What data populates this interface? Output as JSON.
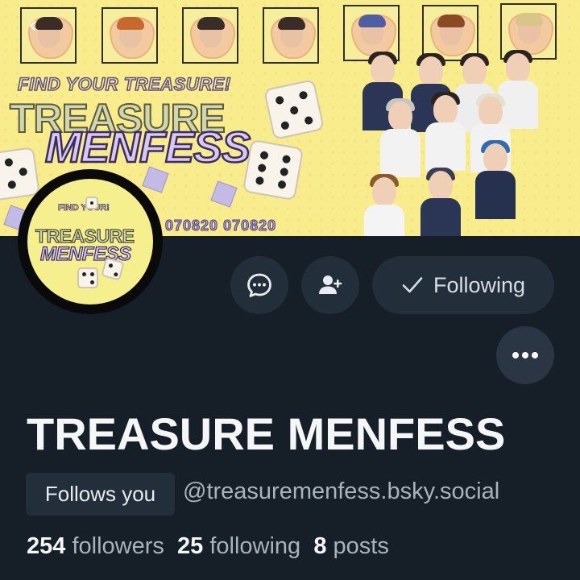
{
  "banner": {
    "tagline": "FIND YOUR TREASURE!",
    "title_line1": "TREASURE",
    "title_line2": "MENFESS",
    "date_strip": "070820 070820"
  },
  "avatar": {
    "small_text": "FIND YOUR!",
    "title_line1": "TREASURE",
    "title_line2": "MENFESS"
  },
  "actions": {
    "message_icon": "chat-bubble-icon",
    "add_user_icon": "person-plus-icon",
    "following_label": "Following",
    "more_icon": "ellipsis-icon"
  },
  "profile": {
    "display_name": "TREASURE MENFESS",
    "follows_you_badge": "Follows you",
    "handle": "@treasuremenfess.bsky.social"
  },
  "stats": {
    "followers_count": "254",
    "followers_label": "followers",
    "following_count": "25",
    "following_label": "following",
    "posts_count": "8",
    "posts_label": "posts"
  },
  "colors": {
    "background": "#161e27",
    "button_bg": "#232e3b",
    "muted_text": "#a9b3be",
    "banner_yellow": "#f8ec8c"
  }
}
